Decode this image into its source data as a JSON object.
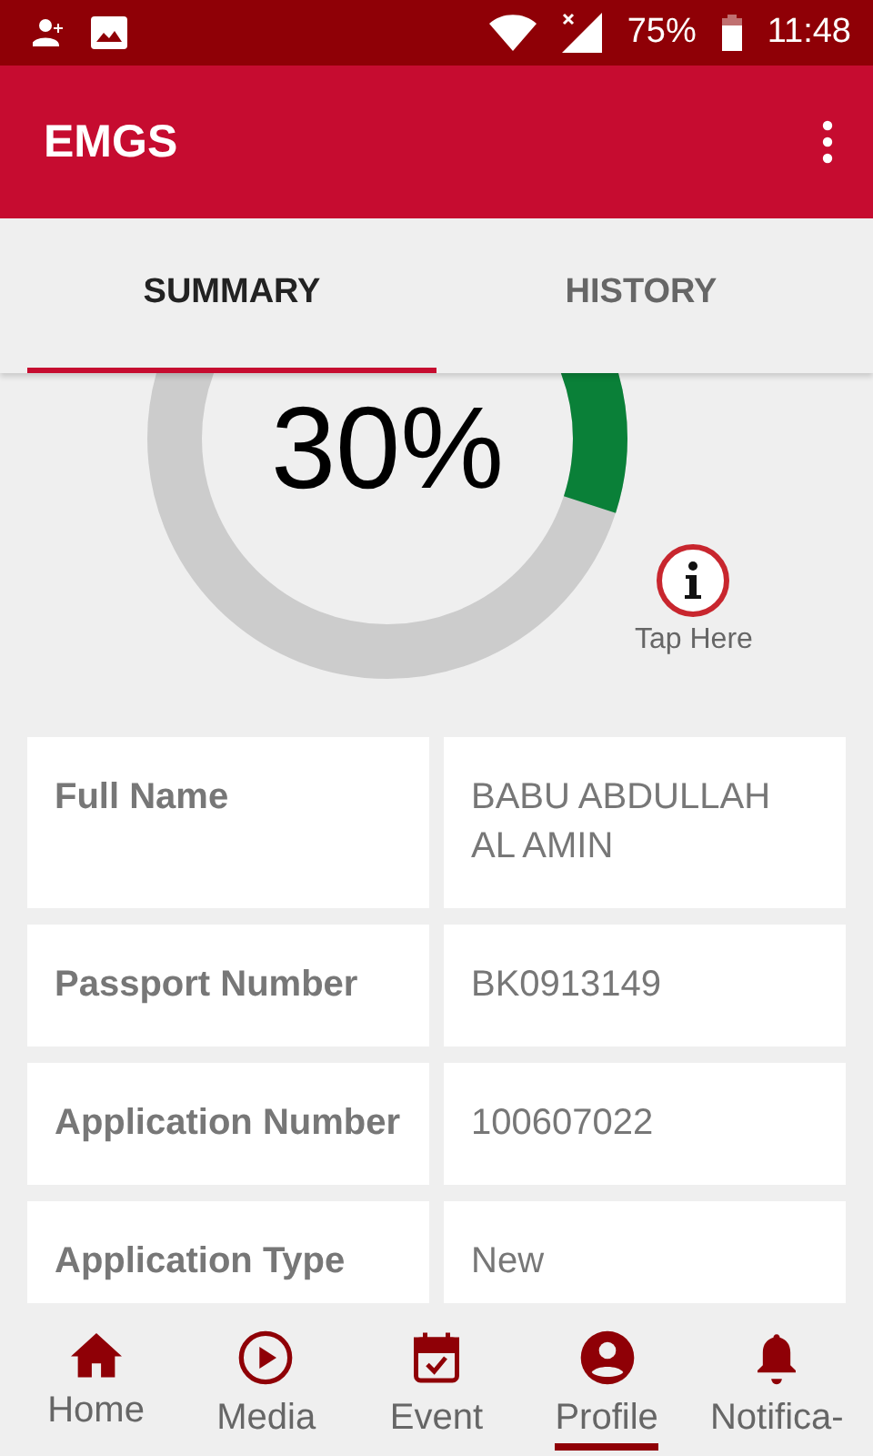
{
  "status_bar": {
    "battery": "75%",
    "time": "11:48"
  },
  "app_bar": {
    "title": "EMGS"
  },
  "tabs": [
    {
      "label": "SUMMARY",
      "selected": true
    },
    {
      "label": "HISTORY",
      "selected": false
    }
  ],
  "progress": {
    "reading": "30%",
    "hint": "Tap Here"
  },
  "details": [
    {
      "label": "Full Name",
      "value": "BABU ABDULLAH AL AMIN"
    },
    {
      "label": "Passport Number",
      "value": "BK0913149"
    },
    {
      "label": "Application Number",
      "value": "100607022"
    },
    {
      "label": "Application Type",
      "value": "New"
    }
  ],
  "nav": [
    {
      "label": "Home",
      "kind": "home",
      "selected": false
    },
    {
      "label": "Media",
      "kind": "media",
      "selected": false
    },
    {
      "label": "Event",
      "kind": "event",
      "selected": false
    },
    {
      "label": "Profile",
      "kind": "profile",
      "selected": true
    },
    {
      "label": "Notifica-",
      "kind": "bell",
      "selected": false
    }
  ]
}
